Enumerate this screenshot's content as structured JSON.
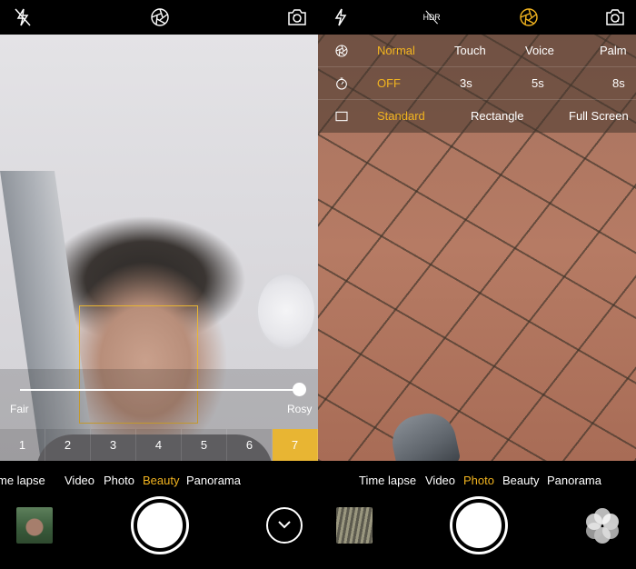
{
  "left": {
    "top_icons": [
      "flash-off-icon",
      "aperture-icon",
      "camera-switch-icon"
    ],
    "beauty": {
      "min_label": "Fair",
      "max_label": "Rosy",
      "levels": [
        "1",
        "2",
        "3",
        "4",
        "5",
        "6",
        "7"
      ],
      "selected_level": "7",
      "slider_value": 1.0
    },
    "modes": [
      "me lapse",
      "Video",
      "Photo",
      "Beauty",
      "Panorama"
    ],
    "active_mode": "Beauty",
    "accent_color": "#e8b533"
  },
  "right": {
    "top_icons": [
      "flash-icon",
      "hdr-off-icon",
      "aperture-active-icon",
      "camera-switch-icon"
    ],
    "hdr_label": "HDR",
    "settings": {
      "capture": {
        "icon": "aperture-icon",
        "options": [
          "Normal",
          "Touch",
          "Voice",
          "Palm"
        ],
        "selected": "Normal"
      },
      "timer": {
        "icon": "timer-icon",
        "options": [
          "OFF",
          "3s",
          "5s",
          "8s"
        ],
        "selected": "OFF"
      },
      "ratio": {
        "icon": "aspect-ratio-icon",
        "options": [
          "Standard",
          "Rectangle",
          "Full Screen"
        ],
        "selected": "Standard"
      }
    },
    "modes": [
      "Time lapse",
      "Video",
      "Photo",
      "Beauty",
      "Panorama"
    ],
    "active_mode": "Photo",
    "accent_color": "#f2b41f"
  }
}
